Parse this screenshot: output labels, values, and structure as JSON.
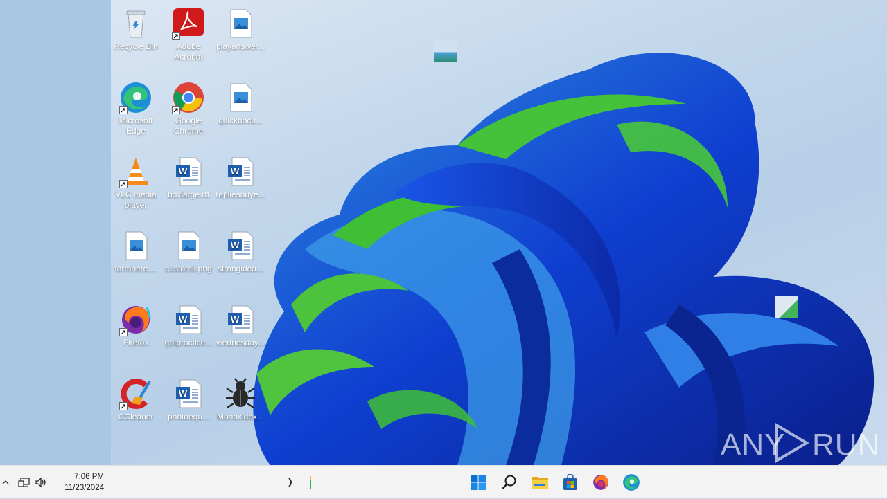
{
  "desktop": {
    "icons": [
      {
        "label": "Recycle Bin",
        "icon": "recycle-bin-icon"
      },
      {
        "label": "Adobe Acrobat",
        "icon": "adobe-acrobat-icon"
      },
      {
        "label": "playanswer...",
        "icon": "image-file-icon"
      },
      {
        "label": "Microsoft Edge",
        "icon": "edge-icon"
      },
      {
        "label": "Google Chrome",
        "icon": "chrome-icon"
      },
      {
        "label": "quickdocu...",
        "icon": "image-file-icon"
      },
      {
        "label": "VLC media player",
        "icon": "vlc-icon"
      },
      {
        "label": "boxlarge.rtf",
        "icon": "word-doc-icon"
      },
      {
        "label": "repliesbuye...",
        "icon": "word-doc-icon"
      },
      {
        "label": "formhere....",
        "icon": "image-file-icon"
      },
      {
        "label": "customil.png",
        "icon": "image-file-icon"
      },
      {
        "label": "strongidea...",
        "icon": "word-doc-icon"
      },
      {
        "label": "Firefox",
        "icon": "firefox-icon"
      },
      {
        "label": "gotpractice...",
        "icon": "word-doc-icon"
      },
      {
        "label": "wednesday...",
        "icon": "word-doc-icon"
      },
      {
        "label": "CCleaner",
        "icon": "ccleaner-icon"
      },
      {
        "label": "photoequ...",
        "icon": "word-doc-icon"
      },
      {
        "label": "Monoxidex...",
        "icon": "bug-icon"
      }
    ]
  },
  "watermark": {
    "left": "ANY",
    "right": "RUN"
  },
  "taskbar": {
    "time": "7:06 PM",
    "date": "11/23/2024",
    "tray_icons": [
      "chevron-up-icon",
      "network-icon",
      "volume-icon"
    ],
    "center_icons": [
      "windows-start-icon",
      "search-icon",
      "file-explorer-icon",
      "store-icon",
      "firefox-icon",
      "edge-icon"
    ],
    "colors": {
      "start": "#0a6fd3",
      "explorer": "#f2c12e",
      "store": "#1f5fb0"
    }
  }
}
